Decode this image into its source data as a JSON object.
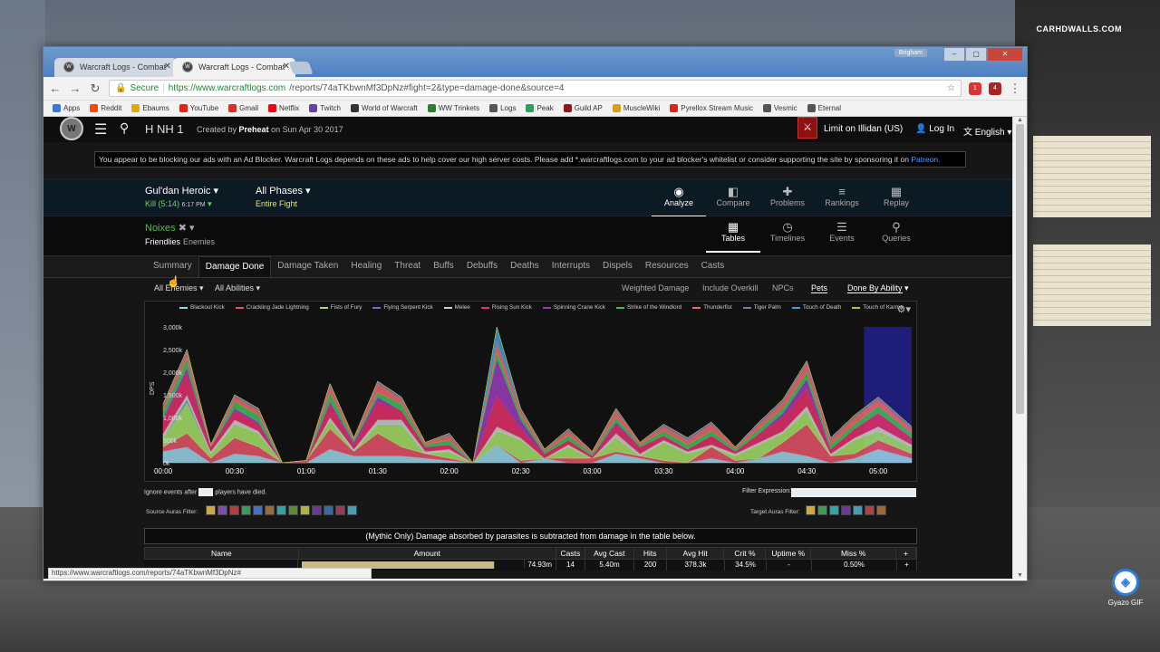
{
  "desktop": {
    "watermark": "CARHDWALLS.COM",
    "gyazo_label": "Gyazo GIF"
  },
  "browser": {
    "tabs": [
      {
        "title": "Warcraft Logs - Combat",
        "favicon": "warcraftlogs-icon"
      },
      {
        "title": "Warcraft Logs - Combat",
        "favicon": "warcraftlogs-icon"
      }
    ],
    "user_badge": "Brigham",
    "secure_label": "Secure",
    "url_host": "https://www.warcraftlogs.com",
    "url_path": "/reports/74aTKbwnMf3DpNz#fight=2&type=damage-done&source=4",
    "extension_badges": [
      "1",
      "4"
    ],
    "bookmarks": [
      {
        "label": "Apps",
        "color": "#3c78d8"
      },
      {
        "label": "Reddit",
        "color": "#ff4500"
      },
      {
        "label": "Ebaums",
        "color": "#e2a900"
      },
      {
        "label": "YouTube",
        "color": "#e62117"
      },
      {
        "label": "Gmail",
        "color": "#d93025"
      },
      {
        "label": "Netflix",
        "color": "#e50914"
      },
      {
        "label": "Twitch",
        "color": "#6441a5"
      },
      {
        "label": "World of Warcraft",
        "color": "#333333"
      },
      {
        "label": "WW Trinkets",
        "color": "#2e7d32"
      },
      {
        "label": "Logs",
        "color": "#555555"
      },
      {
        "label": "Peak",
        "color": "#2e9e5b"
      },
      {
        "label": "Guild AP",
        "color": "#8b1a1a"
      },
      {
        "label": "MuscleWiki",
        "color": "#d4a017"
      },
      {
        "label": "Pyrellox Stream Music",
        "color": "#e62117"
      },
      {
        "label": "Vesmic",
        "color": "#555555"
      },
      {
        "label": "Eternal",
        "color": "#555555"
      }
    ],
    "status_url": "https://www.warcraftlogs.com/reports/74aTKbwnMf3DpNz#"
  },
  "site": {
    "report_title": "H NH 1",
    "created_prefix": "Created by",
    "creator": "Preheat",
    "created_date": "on Sun Apr 30 2017",
    "guild": "Limit on Illidan (US)",
    "login": "Log In",
    "language": "English",
    "ad_text": "You appear to be blocking our ads with an Ad Blocker. Warcraft Logs depends on these ads to help cover our high server costs. Please add *.warcraftlogs.com to your ad blocker's whitelist or consider supporting the site by sponsoring it on",
    "ad_link": "Patreon."
  },
  "fight": {
    "boss": "Gul'dan Heroic",
    "kill": "Kill (5:14)",
    "time": "6:17 PM",
    "phases": "All Phases",
    "phase_selected": "Entire Fight"
  },
  "view_tabs": [
    {
      "label": "Analyze",
      "icon": "eye-icon",
      "glyph": "◉"
    },
    {
      "label": "Compare",
      "icon": "compare-icon",
      "glyph": "◧"
    },
    {
      "label": "Problems",
      "icon": "puzzle-icon",
      "glyph": "✚"
    },
    {
      "label": "Rankings",
      "icon": "rankings-icon",
      "glyph": "≡"
    },
    {
      "label": "Replay",
      "icon": "replay-icon",
      "glyph": "▦"
    }
  ],
  "player": {
    "name": "Noixes",
    "friendlies": "Friendlies",
    "enemies": "Enemies"
  },
  "mode_tabs": [
    {
      "label": "Tables",
      "icon": "table-icon",
      "glyph": "▦"
    },
    {
      "label": "Timelines",
      "icon": "clock-icon",
      "glyph": "◷"
    },
    {
      "label": "Events",
      "icon": "list-icon",
      "glyph": "☰"
    },
    {
      "label": "Queries",
      "icon": "pin-icon",
      "glyph": "⚲"
    }
  ],
  "subtabs": [
    "Summary",
    "Damage Done",
    "Damage Taken",
    "Healing",
    "Threat",
    "Buffs",
    "Debuffs",
    "Deaths",
    "Interrupts",
    "Dispels",
    "Resources",
    "Casts"
  ],
  "filters": {
    "enemies": "All Enemies",
    "abilities": "All Abilities",
    "weighted": "Weighted Damage",
    "overkill": "Include Overkill",
    "npcs": "NPCs",
    "pets": "Pets",
    "done_by": "Done By Ability"
  },
  "chart_data": {
    "type": "area",
    "ylabel": "DPS",
    "yticks": [
      "0k",
      "500k",
      "1,000k",
      "1,500k",
      "2,000k",
      "2,500k",
      "3,000k"
    ],
    "xticks": [
      "00:00",
      "00:30",
      "01:00",
      "01:30",
      "02:00",
      "02:30",
      "03:00",
      "03:30",
      "04:00",
      "04:30",
      "05:00"
    ],
    "ylim": [
      0,
      3000
    ],
    "xlim": [
      0,
      314
    ],
    "x": [
      0,
      10,
      20,
      30,
      40,
      50,
      60,
      70,
      80,
      90,
      100,
      110,
      120,
      130,
      140,
      150,
      160,
      170,
      180,
      190,
      200,
      210,
      220,
      230,
      240,
      250,
      260,
      270,
      280,
      290,
      300,
      314
    ],
    "series": [
      {
        "name": "Blackout Kick",
        "color": "#9ad6ea",
        "values": [
          250,
          350,
          0,
          200,
          150,
          0,
          0,
          300,
          150,
          150,
          150,
          100,
          50,
          0,
          400,
          0,
          100,
          0,
          0,
          200,
          100,
          0,
          0,
          100,
          0,
          100,
          250,
          150,
          0,
          100,
          300,
          100
        ]
      },
      {
        "name": "Crackling Jade Lightning",
        "color": "#e8556a",
        "values": [
          100,
          300,
          100,
          350,
          200,
          0,
          50,
          450,
          100,
          500,
          200,
          100,
          50,
          0,
          0,
          50,
          0,
          100,
          100,
          50,
          50,
          50,
          0,
          250,
          50,
          0,
          200,
          700,
          150,
          100,
          200,
          100
        ]
      },
      {
        "name": "Fists of Fury",
        "color": "#a6e067",
        "values": [
          200,
          700,
          100,
          300,
          300,
          0,
          0,
          200,
          0,
          200,
          500,
          0,
          150,
          0,
          300,
          450,
          0,
          250,
          0,
          300,
          0,
          400,
          200,
          0,
          100,
          300,
          200,
          300,
          0,
          300,
          200,
          150
        ]
      },
      {
        "name": "Flying Serpent Kick",
        "color": "#5577dd",
        "values": [
          0,
          50,
          0,
          0,
          0,
          0,
          0,
          0,
          0,
          0,
          0,
          0,
          0,
          0,
          0,
          0,
          0,
          0,
          0,
          0,
          0,
          0,
          0,
          0,
          0,
          0,
          0,
          0,
          0,
          0,
          0,
          0
        ]
      },
      {
        "name": "Melee",
        "color": "#cccccc",
        "values": [
          100,
          100,
          50,
          100,
          50,
          0,
          0,
          50,
          50,
          100,
          100,
          50,
          50,
          0,
          100,
          50,
          0,
          50,
          0,
          100,
          50,
          50,
          50,
          50,
          50,
          50,
          50,
          100,
          50,
          50,
          100,
          50
        ]
      },
      {
        "name": "Rising Sun Kick",
        "color": "#e3306a",
        "values": [
          300,
          500,
          100,
          200,
          150,
          0,
          0,
          300,
          100,
          400,
          200,
          100,
          100,
          0,
          700,
          200,
          100,
          100,
          50,
          200,
          150,
          100,
          50,
          200,
          50,
          200,
          300,
          400,
          100,
          200,
          300,
          150
        ]
      },
      {
        "name": "Spinning Crane Kick",
        "color": "#9a3dbd",
        "values": [
          50,
          100,
          0,
          50,
          50,
          0,
          0,
          50,
          50,
          100,
          0,
          0,
          0,
          0,
          800,
          200,
          0,
          0,
          0,
          50,
          0,
          0,
          0,
          0,
          0,
          0,
          100,
          200,
          0,
          0,
          0,
          0
        ]
      },
      {
        "name": "Strike of the Windlord",
        "color": "#3fbf5a",
        "values": [
          150,
          200,
          0,
          150,
          150,
          0,
          0,
          200,
          50,
          100,
          150,
          50,
          100,
          0,
          150,
          100,
          50,
          100,
          50,
          100,
          50,
          100,
          100,
          100,
          50,
          100,
          100,
          150,
          100,
          100,
          150,
          100
        ]
      },
      {
        "name": "Thunderfist",
        "color": "#f06a6a",
        "values": [
          100,
          150,
          50,
          100,
          100,
          0,
          0,
          150,
          50,
          200,
          100,
          50,
          100,
          0,
          200,
          100,
          50,
          100,
          50,
          150,
          50,
          100,
          100,
          150,
          50,
          100,
          150,
          200,
          100,
          150,
          150,
          100
        ]
      },
      {
        "name": "Tiger Palm",
        "color": "#7a7aa8",
        "values": [
          50,
          50,
          0,
          50,
          50,
          0,
          0,
          50,
          0,
          50,
          50,
          0,
          50,
          0,
          50,
          50,
          0,
          50,
          0,
          50,
          0,
          50,
          50,
          50,
          0,
          50,
          50,
          50,
          50,
          50,
          50,
          50
        ]
      },
      {
        "name": "Touch of Death",
        "color": "#3aa0d8",
        "values": [
          0,
          0,
          0,
          0,
          0,
          0,
          0,
          0,
          0,
          0,
          0,
          0,
          0,
          0,
          300,
          0,
          0,
          0,
          0,
          0,
          0,
          0,
          0,
          0,
          0,
          0,
          0,
          0,
          0,
          0,
          0,
          0
        ]
      },
      {
        "name": "Touch of Karma",
        "color": "#c0c03a",
        "values": [
          0,
          0,
          0,
          0,
          0,
          0,
          0,
          0,
          0,
          0,
          0,
          0,
          0,
          0,
          0,
          0,
          0,
          0,
          0,
          0,
          0,
          0,
          0,
          0,
          0,
          0,
          0,
          0,
          0,
          0,
          0,
          0
        ]
      }
    ],
    "highlight_band": [
      294,
      314
    ]
  },
  "chart_options": {
    "ignore_prefix": "Ignore events after",
    "ignore_suffix": "players have died.",
    "filter_expression": "Filter Expression:",
    "source_auras": "Source Auras Filter:",
    "target_auras": "Target Auras Filter:"
  },
  "notice": "(Mythic Only) Damage absorbed by parasites is subtracted from damage in the table below.",
  "table": {
    "columns": [
      "Name",
      "Amount",
      "Casts",
      "Avg Cast",
      "Hits",
      "Avg Hit",
      "Crit %",
      "Uptime %",
      "Miss %",
      "+"
    ],
    "rows": [
      {
        "amount": "74.93m",
        "amount_fraction": 0.87,
        "casts": "14",
        "avg_cast": "5.40m",
        "hits": "200",
        "avg_hit": "378.3k",
        "crit": "34.5%",
        "uptime": "-",
        "miss": "0.50%",
        "plus": "+"
      }
    ]
  }
}
